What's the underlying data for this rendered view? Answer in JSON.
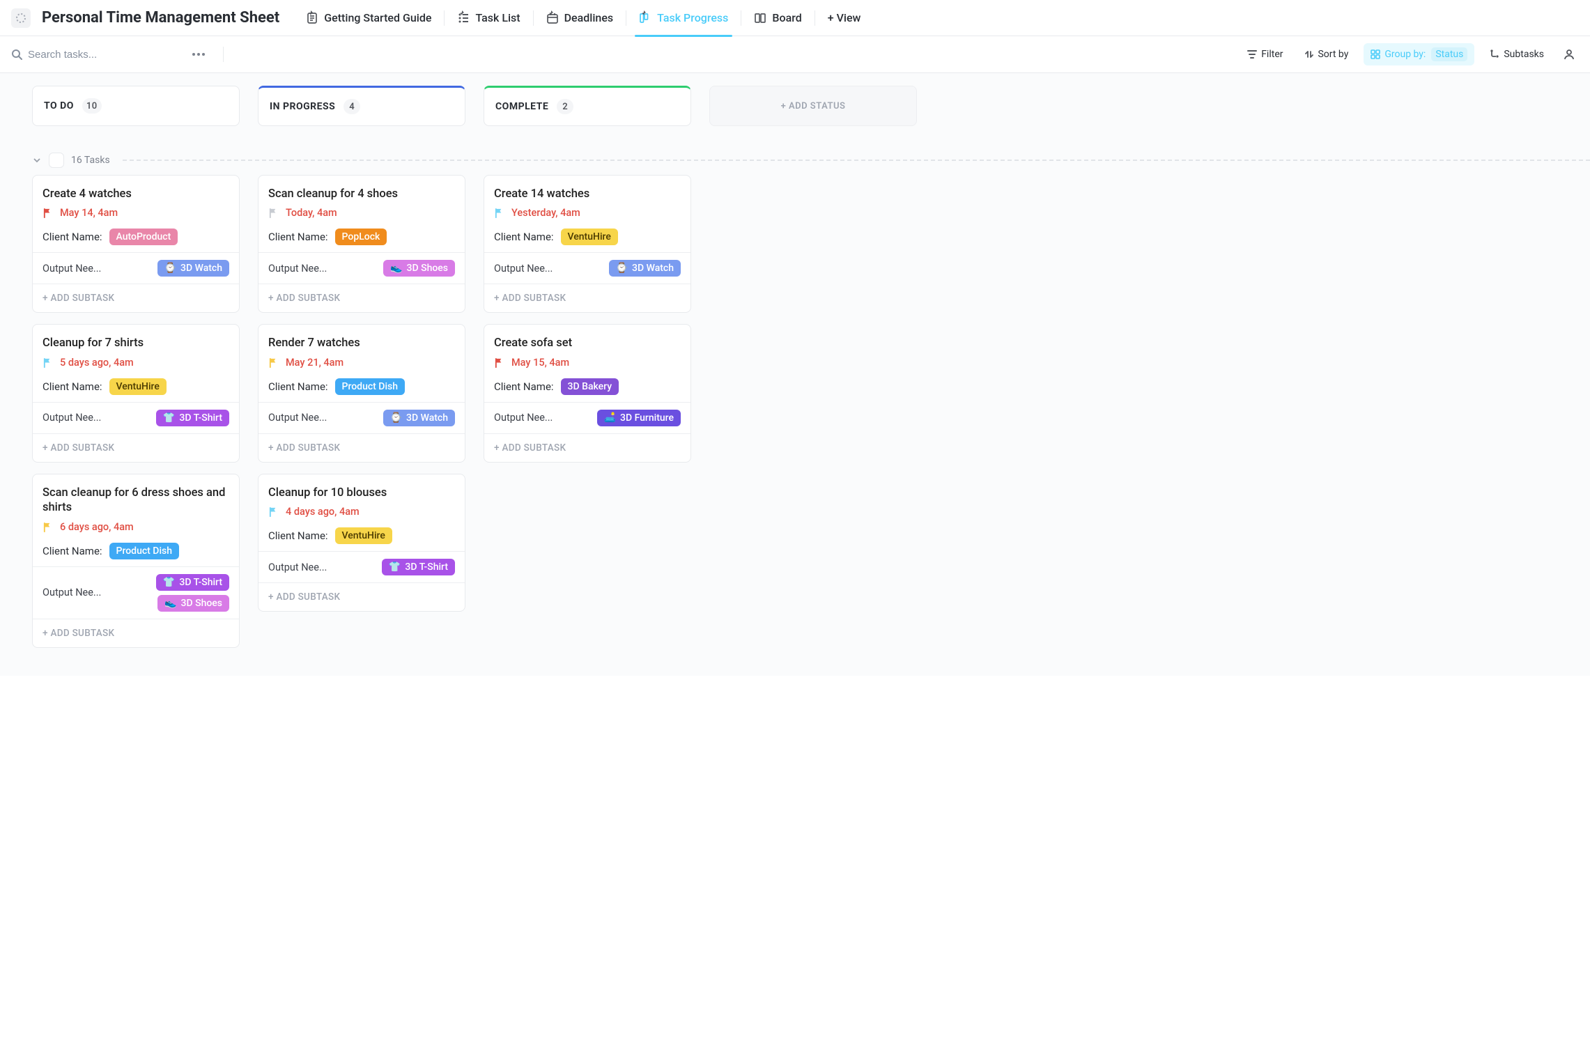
{
  "title": "Personal Time Management Sheet",
  "views": [
    {
      "label": "Getting Started Guide",
      "icon": "doc",
      "active": false,
      "pinned": true
    },
    {
      "label": "Task List",
      "icon": "list",
      "active": false,
      "pinned": true
    },
    {
      "label": "Deadlines",
      "icon": "calendar",
      "active": false,
      "pinned": true
    },
    {
      "label": "Task Progress",
      "icon": "board",
      "active": true,
      "pinned": true
    },
    {
      "label": "Board",
      "icon": "board-plain",
      "active": false,
      "pinned": false
    }
  ],
  "add_view": "+ View",
  "toolbar": {
    "search_placeholder": "Search tasks...",
    "filter": "Filter",
    "sortby": "Sort by",
    "groupby_label": "Group by:",
    "groupby_value": "Status",
    "subtasks": "Subtasks"
  },
  "columns": [
    {
      "id": "todo",
      "label": "TO DO",
      "count": 10,
      "accent": "none"
    },
    {
      "id": "inprogress",
      "label": "IN PROGRESS",
      "count": 4,
      "accent": "blue"
    },
    {
      "id": "complete",
      "label": "COMPLETE",
      "count": 2,
      "accent": "green"
    }
  ],
  "add_status_label": "+ ADD STATUS",
  "group": {
    "label": "16 Tasks"
  },
  "add_subtask_label": "+ ADD SUBTASK",
  "client_label": "Client Name:",
  "output_label": "Output Needed:",
  "cards": {
    "todo": [
      {
        "title": "Create 4 watches",
        "flag": "red",
        "date": "May 14, 4am",
        "client": {
          "name": "AutoProduct",
          "cls": "c-autoproduct"
        },
        "output": [
          {
            "name": "3D Watch",
            "emoji": "⌚",
            "cls": "o-watch"
          }
        ]
      },
      {
        "title": "Cleanup for 7 shirts",
        "flag": "blue",
        "date": "5 days ago, 4am",
        "client": {
          "name": "VentuHire",
          "cls": "c-ventuhire"
        },
        "output": [
          {
            "name": "3D T-Shirt",
            "emoji": "👕",
            "cls": "o-tshirt"
          }
        ]
      },
      {
        "title": "Scan cleanup for 6 dress shoes and shirts",
        "flag": "yellow",
        "date": "6 days ago, 4am",
        "client": {
          "name": "Product Dish",
          "cls": "c-productdish"
        },
        "output": [
          {
            "name": "3D T-Shirt",
            "emoji": "👕",
            "cls": "o-tshirt"
          },
          {
            "name": "3D Shoes",
            "emoji": "👟",
            "cls": "o-shoes"
          }
        ]
      }
    ],
    "inprogress": [
      {
        "title": "Scan cleanup for 4 shoes",
        "flag": "grey",
        "date": "Today, 4am",
        "client": {
          "name": "PopLock",
          "cls": "c-poplock"
        },
        "output": [
          {
            "name": "3D Shoes",
            "emoji": "👟",
            "cls": "o-shoes"
          }
        ]
      },
      {
        "title": "Render 7 watches",
        "flag": "yellow",
        "date": "May 21, 4am",
        "client": {
          "name": "Product Dish",
          "cls": "c-productdish"
        },
        "output": [
          {
            "name": "3D Watch",
            "emoji": "⌚",
            "cls": "o-watch"
          }
        ]
      },
      {
        "title": "Cleanup for 10 blouses",
        "flag": "blue",
        "date": "4 days ago, 4am",
        "client": {
          "name": "VentuHire",
          "cls": "c-ventuhire"
        },
        "output": [
          {
            "name": "3D T-Shirt",
            "emoji": "👕",
            "cls": "o-tshirt"
          }
        ]
      }
    ],
    "complete": [
      {
        "title": "Create 14 watches",
        "flag": "blue",
        "date": "Yesterday, 4am",
        "client": {
          "name": "VentuHire",
          "cls": "c-ventuhire"
        },
        "output": [
          {
            "name": "3D Watch",
            "emoji": "⌚",
            "cls": "o-watch"
          }
        ]
      },
      {
        "title": "Create sofa set",
        "flag": "red",
        "date": "May 15, 4am",
        "client": {
          "name": "3D Bakery",
          "cls": "c-3dbakery"
        },
        "output": [
          {
            "name": "3D Furniture",
            "emoji": "🛋️",
            "cls": "o-furn"
          }
        ]
      }
    ]
  }
}
